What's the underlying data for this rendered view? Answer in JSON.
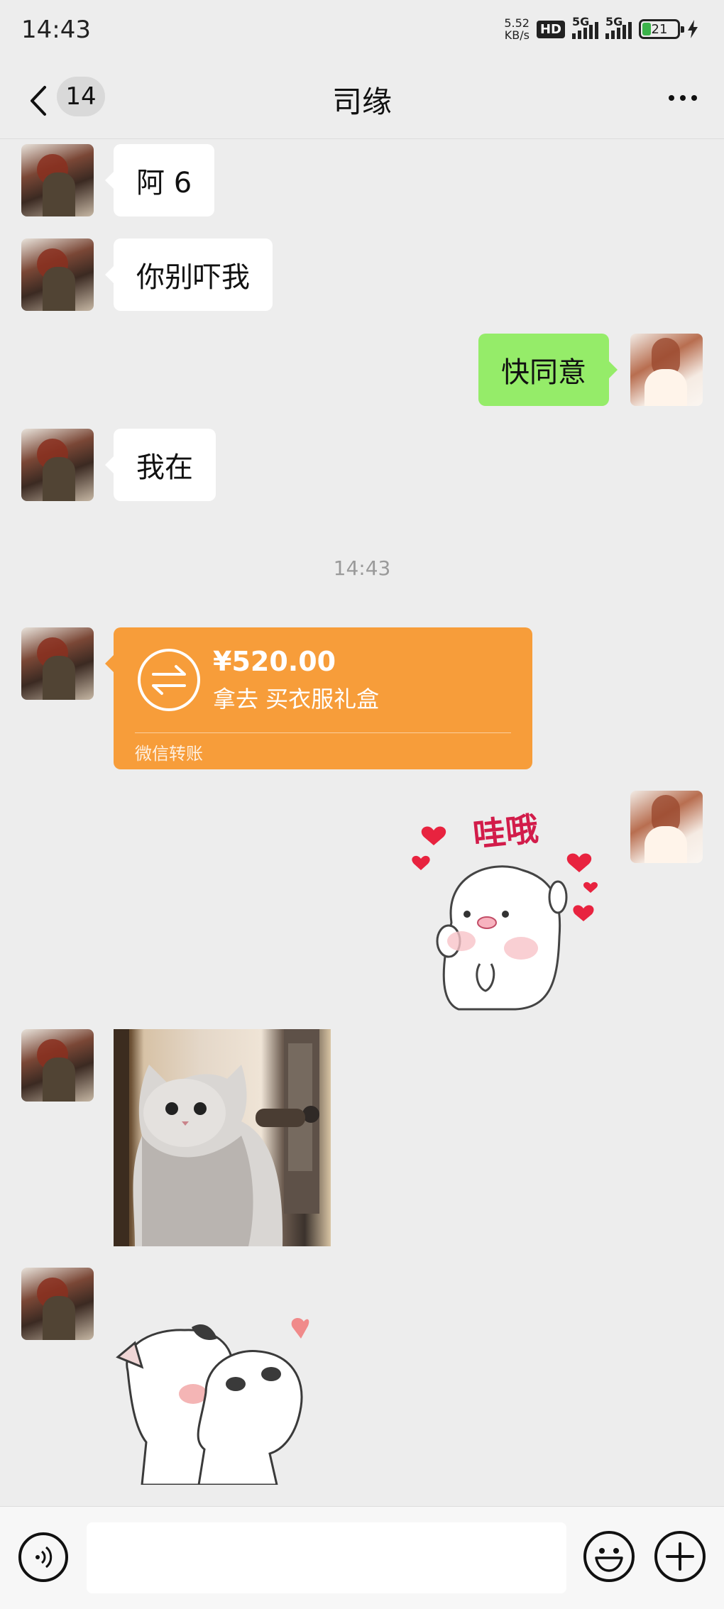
{
  "status_bar": {
    "time": "14:43",
    "net_speed_value": "5.52",
    "net_speed_unit": "KB/s",
    "hd_label": "HD",
    "signal_label_1": "5G",
    "signal_label_2": "5G",
    "battery_level": "21"
  },
  "header": {
    "unread_count": "14",
    "title": "司缘"
  },
  "messages": [
    {
      "side": "in",
      "text": "阿 6"
    },
    {
      "side": "in",
      "text": "你别吓我"
    },
    {
      "side": "out",
      "text": "快同意"
    },
    {
      "side": "in",
      "text": "我在"
    }
  ],
  "timestamp": "14:43",
  "transfer": {
    "amount": "¥520.00",
    "note": "拿去   买衣服礼盒",
    "label": "微信转账"
  },
  "stickers": {
    "wow_text": "哇哦"
  },
  "composer": {
    "input_value": ""
  },
  "colors": {
    "chat_bg": "#ededed",
    "outgoing_bubble": "#95ec69",
    "incoming_bubble": "#ffffff",
    "transfer_card": "#f79d3a"
  }
}
